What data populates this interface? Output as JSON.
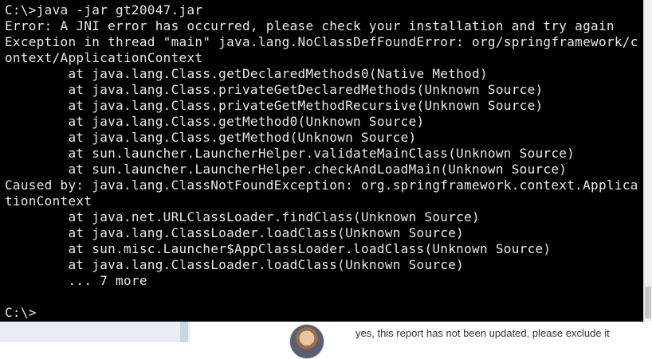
{
  "console": {
    "lines": [
      "C:\\>java -jar gt20047.jar",
      "Error: A JNI error has occurred, please check your installation and try again",
      "Exception in thread \"main\" java.lang.NoClassDefFoundError: org/springframework/c",
      "ontext/ApplicationContext",
      "        at java.lang.Class.getDeclaredMethods0(Native Method)",
      "        at java.lang.Class.privateGetDeclaredMethods(Unknown Source)",
      "        at java.lang.Class.privateGetMethodRecursive(Unknown Source)",
      "        at java.lang.Class.getMethod0(Unknown Source)",
      "        at java.lang.Class.getMethod(Unknown Source)",
      "        at sun.launcher.LauncherHelper.validateMainClass(Unknown Source)",
      "        at sun.launcher.LauncherHelper.checkAndLoadMain(Unknown Source)",
      "Caused by: java.lang.ClassNotFoundException: org.springframework.context.Applica",
      "tionContext",
      "        at java.net.URLClassLoader.findClass(Unknown Source)",
      "        at java.lang.ClassLoader.loadClass(Unknown Source)",
      "        at sun.misc.Launcher$AppClassLoader.loadClass(Unknown Source)",
      "        at java.lang.ClassLoader.loadClass(Unknown Source)",
      "        ... 7 more",
      "",
      "C:\\>"
    ],
    "colors": {
      "background": "#000000",
      "text": "#e8e8e8"
    }
  },
  "comment": {
    "avatar_icon": "user-avatar",
    "text": "yes, this report has not been updated, please exclude it"
  }
}
